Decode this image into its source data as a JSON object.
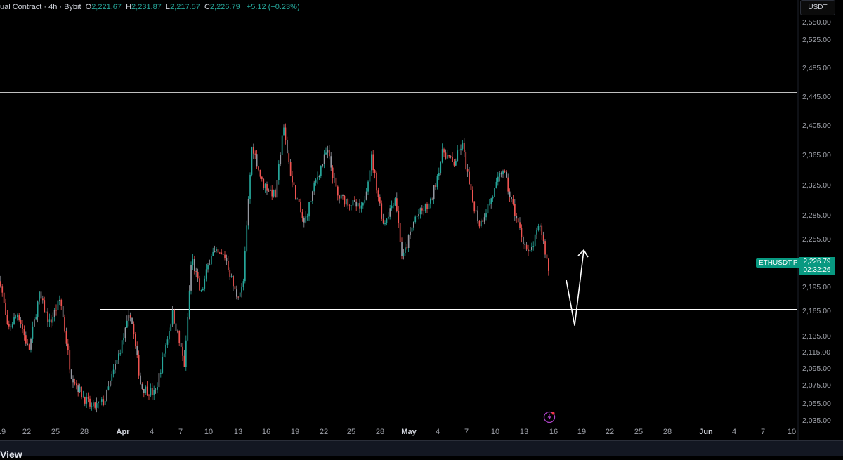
{
  "header": {
    "title": "ual Contract · 4h · Bybit",
    "o_label": "O",
    "o_value": "2,221.67",
    "h_label": "H",
    "h_value": "2,231.87",
    "l_label": "L",
    "l_value": "2,217.57",
    "c_label": "C",
    "c_value": "2,226.79",
    "change": "+5.12 (+0.23%)"
  },
  "currency_button": "USDT",
  "price_axis": {
    "labels": [
      "2,550.00",
      "2,525.00",
      "2,485.00",
      "2,445.00",
      "2,405.00",
      "2,365.00",
      "2,325.00",
      "2,285.00",
      "2,255.00",
      "2,195.00",
      "2,165.00",
      "2,135.00",
      "2,115.00",
      "2,095.00",
      "2,075.00",
      "2,055.00",
      "2,035.00"
    ]
  },
  "time_axis": {
    "labels": [
      {
        "text": "19",
        "bold": false
      },
      {
        "text": "22",
        "bold": false
      },
      {
        "text": "25",
        "bold": false
      },
      {
        "text": "28",
        "bold": false
      },
      {
        "text": "Apr",
        "bold": true
      },
      {
        "text": "4",
        "bold": false
      },
      {
        "text": "7",
        "bold": false
      },
      {
        "text": "10",
        "bold": false
      },
      {
        "text": "13",
        "bold": false
      },
      {
        "text": "16",
        "bold": false
      },
      {
        "text": "19",
        "bold": false
      },
      {
        "text": "22",
        "bold": false
      },
      {
        "text": "25",
        "bold": false
      },
      {
        "text": "28",
        "bold": false
      },
      {
        "text": "May",
        "bold": true
      },
      {
        "text": "4",
        "bold": false
      },
      {
        "text": "7",
        "bold": false
      },
      {
        "text": "10",
        "bold": false
      },
      {
        "text": "13",
        "bold": false
      },
      {
        "text": "16",
        "bold": false
      },
      {
        "text": "19",
        "bold": false
      },
      {
        "text": "22",
        "bold": false
      },
      {
        "text": "25",
        "bold": false
      },
      {
        "text": "28",
        "bold": false
      },
      {
        "text": "Jun",
        "bold": true
      },
      {
        "text": "4",
        "bold": false
      },
      {
        "text": "7",
        "bold": false
      },
      {
        "text": "10",
        "bold": false
      }
    ]
  },
  "last_price": {
    "symbol": "ETHUSDT.P",
    "price": "2,226.79",
    "countdown": "02:32:26"
  },
  "horizontal_lines": [
    2477,
    2170
  ],
  "projection_path": [
    {
      "date": "May 17",
      "price": 2212
    },
    {
      "date": "May 18",
      "price": 2147
    },
    {
      "date": "May 19",
      "price": 2254
    }
  ],
  "colors": {
    "up": "#26a69a",
    "down": "#ef5350",
    "wick": "#9598a1",
    "line": "#ffffff",
    "tag": "#089981"
  },
  "icons": {
    "event": "lightning-icon"
  },
  "brand_fragment": "View"
}
